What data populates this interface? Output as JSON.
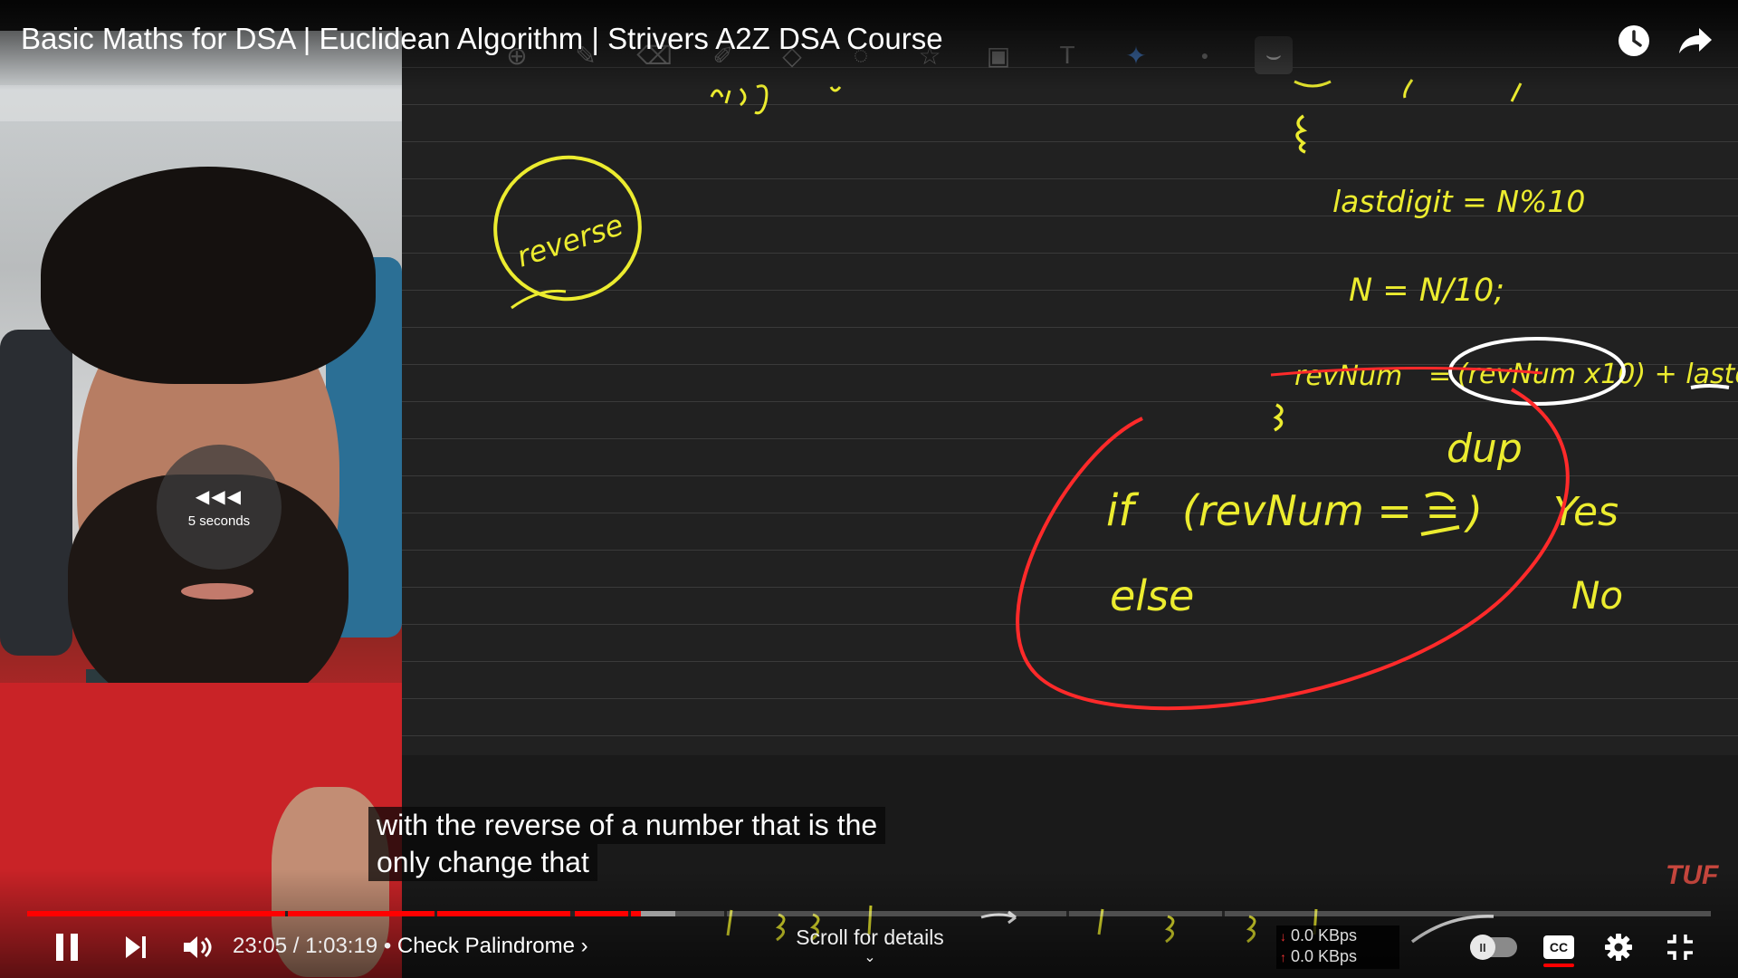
{
  "title_bar": {
    "title": "Basic Maths for DSA | Euclidean Algorithm | Strivers A2Z DSA Course",
    "watch_later_icon": "clock-icon",
    "share_icon": "share-arrow-icon"
  },
  "board_toolbar": {
    "tools": [
      "zoom-add-icon",
      "pen-icon",
      "eraser-icon",
      "highlighter-icon",
      "shapes-icon",
      "lasso-icon",
      "sticker-icon",
      "image-icon",
      "text-box-icon",
      "laser-pointer-icon",
      "dot-icon",
      "curve-icon"
    ]
  },
  "overlay": {
    "rewind_label": "5 seconds",
    "rewind_icon": "rewind-icon"
  },
  "captions": {
    "line1": "with the reverse of a number that is the",
    "line2": "only change that"
  },
  "watermark": "TUF",
  "controls": {
    "current_time": "23:05",
    "separator": "/",
    "duration": "1:03:19",
    "chapter_prefix": "•",
    "chapter": "Check Palindrome",
    "chapter_chevron": "›",
    "scroll_hint": "Scroll for details",
    "scroll_chevron": "⌄",
    "played_fraction": 0.3645,
    "buffered_fraction": 0.385,
    "net_down": "0.0 KBps",
    "net_up": "0.0 KBps",
    "autoplay_state": "paused",
    "accent": "#ff0000"
  },
  "colors": {
    "ink_yellow": "#ecec2f",
    "ink_red": "#ff2a2a",
    "ink_white": "#ffffff",
    "board_bg": "#212121"
  }
}
